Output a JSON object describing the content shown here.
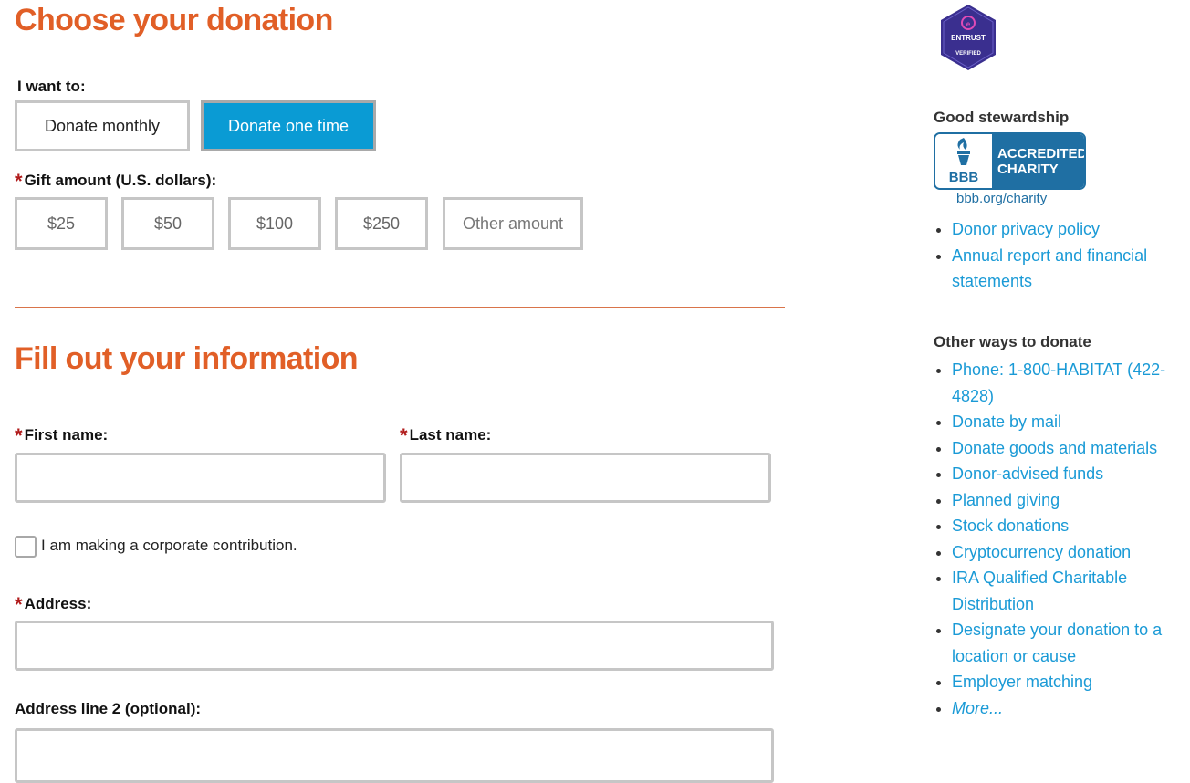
{
  "donation": {
    "heading": "Choose your donation",
    "want_label": "I want to:",
    "frequency": {
      "monthly": "Donate monthly",
      "one_time": "Donate one time",
      "selected": "one_time"
    },
    "required_mark": "*",
    "gift_label": "Gift amount (U.S. dollars):",
    "amounts": [
      "$25",
      "$50",
      "$100",
      "$250"
    ],
    "other_amount_placeholder": "Other amount"
  },
  "info": {
    "heading": "Fill out your information",
    "first_name_label": "First name:",
    "last_name_label": "Last name:",
    "first_name_value": "",
    "last_name_value": "",
    "corporate_label": "I am making a corporate contribution.",
    "corporate_checked": false,
    "address_label": "Address:",
    "address_value": "",
    "address2_label": "Address line 2 (optional):",
    "address2_value": ""
  },
  "sidebar": {
    "entrust_badge": {
      "line1": "ENTRUST",
      "line2": "VERIFIED"
    },
    "stewardship_heading": "Good stewardship",
    "bbb": {
      "logo": "BBB",
      "line1": "ACCREDITED",
      "line2": "CHARITY",
      "url": "bbb.org/charity"
    },
    "stewardship_links": [
      "Donor privacy policy",
      "Annual report and financial statements"
    ],
    "other_ways_heading": "Other ways to donate",
    "other_ways_links": [
      "Phone: 1-800-HABITAT (422-4828)",
      "Donate by mail",
      "Donate goods and materials",
      "Donor-advised funds",
      "Planned giving",
      "Stock donations",
      "Cryptocurrency donation",
      "IRA Qualified Charitable Distribution",
      "Designate your donation to a location or cause",
      "Employer matching",
      "More..."
    ]
  },
  "colors": {
    "heading_orange": "#e15f27",
    "active_blue": "#0a9bd4",
    "link_blue": "#1a9ad6",
    "required_red": "#b11c1c"
  }
}
